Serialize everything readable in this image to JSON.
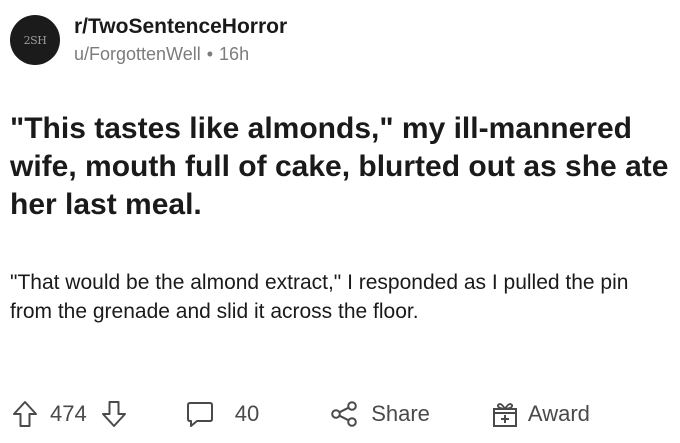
{
  "post": {
    "subreddit": "r/TwoSentenceHorror",
    "avatar_text": "2SH",
    "author": "u/ForgottenWell",
    "separator": "•",
    "age": "16h",
    "title": "\"This tastes like almonds,\" my ill-mannered wife, mouth full of cake, blurted out as she ate her last meal.",
    "body": "\"That would be the almond extract,\" I responded as I pulled the pin from the grenade and slid it across the floor."
  },
  "actions": {
    "votes": "474",
    "comments": "40",
    "share_label": "Share",
    "award_label": "Award"
  },
  "icons": {
    "upvote": "upvote-arrow-icon",
    "downvote": "downvote-arrow-icon",
    "comment": "comment-bubble-icon",
    "share": "share-icon",
    "award": "gift-award-icon"
  },
  "colors": {
    "text": "#1a1a1b",
    "muted": "#7c7c7c",
    "icon": "#4a4a4a"
  }
}
